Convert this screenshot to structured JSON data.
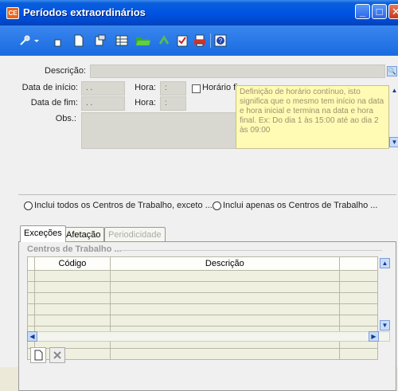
{
  "window": {
    "title": "Períodos extraordinários",
    "app_icon_text": "CE"
  },
  "form": {
    "descricao_label": "Descrição:",
    "descricao_value": "",
    "data_inicio_label": "Data de início:",
    "data_inicio_value": ". .",
    "hora1_label": "Hora:",
    "hora1_value": ":",
    "horario_fixo_label": "Horário fixo",
    "data_fim_label": "Data de fim:",
    "data_fim_value": ". .",
    "hora2_label": "Hora:",
    "hora2_value": ":",
    "obs_label": "Obs.:",
    "obs_value": "",
    "note_text": "Definição de horário contínuo, isto significa que o mesmo tem início na data e hora inicial e termina na data e hora final. Ex: Do dia 1 às 15:00 até ao dia 2 às 09:00"
  },
  "options": {
    "radio1_label": "Inclui todos os Centros de Trabalho, exceto ...",
    "radio2_label": "Inclui apenas os Centros de Trabalho ..."
  },
  "tabs": [
    {
      "label": "Exceções"
    },
    {
      "label": "Afetação"
    },
    {
      "label": "Periodicidade"
    }
  ],
  "panel": {
    "group_title": "Centros de Trabalho ...",
    "columns": [
      "Código",
      "Descrição"
    ],
    "row_count_visible": 9
  },
  "colors": {
    "titlebar": "#0054e3",
    "note_bg": "#fffbb4",
    "field_bg": "#d8d8d0"
  }
}
